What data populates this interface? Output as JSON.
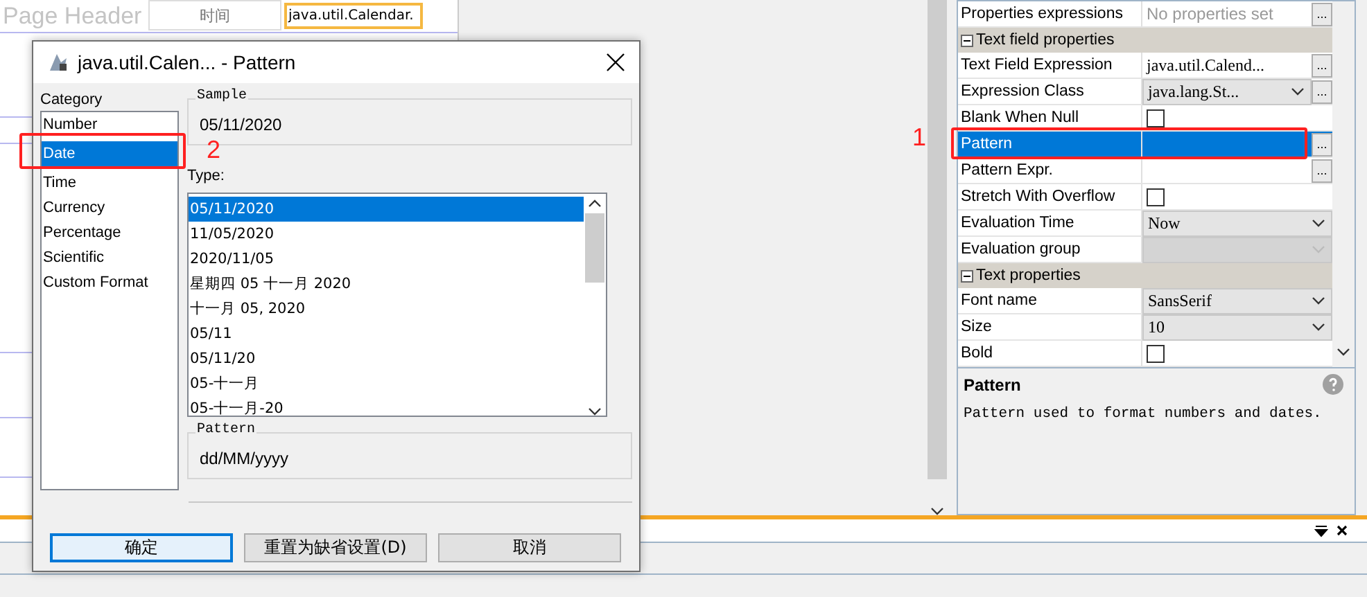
{
  "designer": {
    "header_label": "Page Header",
    "cells": [
      {
        "text": "时间",
        "kind": "static",
        "selected": false
      },
      {
        "text": "java.util.Calendar.",
        "kind": "field",
        "selected": true
      }
    ]
  },
  "properties": {
    "rows": [
      {
        "kind": "text",
        "label": "Properties expressions",
        "value": "No properties set",
        "muted": true,
        "ellipsis": "...",
        "selected": false
      },
      {
        "kind": "section",
        "label": "Text field properties"
      },
      {
        "kind": "text",
        "label": "Text Field Expression",
        "value": "java.util.Calend...",
        "muted": false,
        "ellipsis": "...",
        "selected": false
      },
      {
        "kind": "combo",
        "label": "Expression Class",
        "value": "java.lang.St...",
        "ellipsis": "...",
        "disabled": false,
        "selected": false
      },
      {
        "kind": "check",
        "label": "Blank When Null",
        "checked": false,
        "selected": false
      },
      {
        "kind": "text",
        "label": "Pattern",
        "ellipsis": "...",
        "selected": true
      },
      {
        "kind": "text",
        "label": "Pattern Expr.",
        "ellipsis": "...",
        "selected": false
      },
      {
        "kind": "check",
        "label": "Stretch With Overflow",
        "checked": false,
        "selected": false
      },
      {
        "kind": "combo",
        "label": "Evaluation Time",
        "value": "Now",
        "disabled": false,
        "selected": false
      },
      {
        "kind": "combo",
        "label": "Evaluation group",
        "disabled": true,
        "selected": false
      },
      {
        "kind": "section",
        "label": "Text properties"
      },
      {
        "kind": "combo",
        "label": "Font name",
        "value": "SansSerif",
        "disabled": false,
        "selected": false
      },
      {
        "kind": "combo",
        "label": "Size",
        "value": "10",
        "disabled": false,
        "selected": false
      },
      {
        "kind": "check",
        "label": "Bold",
        "checked": false,
        "selected": false
      }
    ],
    "help": {
      "title": "Pattern",
      "text": "Pattern used to format numbers and dates."
    }
  },
  "dialog": {
    "title": "java.util.Calen... - Pattern",
    "category_label": "Category",
    "categories": [
      {
        "label": "Number",
        "selected": false
      },
      {
        "label": "Date",
        "selected": true
      },
      {
        "label": "Time",
        "selected": false
      },
      {
        "label": "Currency",
        "selected": false
      },
      {
        "label": "Percentage",
        "selected": false
      },
      {
        "label": "Scientific",
        "selected": false
      },
      {
        "label": "Custom Format",
        "selected": false
      }
    ],
    "sample_label": "Sample",
    "sample": "05/11/2020",
    "type_label": "Type:",
    "types": [
      {
        "label": "05/11/2020",
        "selected": true
      },
      {
        "label": "11/05/2020",
        "selected": false
      },
      {
        "label": "2020/11/05",
        "selected": false
      },
      {
        "label": "星期四 05 十一月 2020",
        "selected": false
      },
      {
        "label": "十一月 05, 2020",
        "selected": false
      },
      {
        "label": "05/11",
        "selected": false
      },
      {
        "label": "05/11/20",
        "selected": false
      },
      {
        "label": "05-十一月",
        "selected": false
      },
      {
        "label": "05-十一月-20",
        "selected": false
      }
    ],
    "pattern_label": "Pattern",
    "pattern": "dd/MM/yyyy",
    "buttons": [
      {
        "label": "确定",
        "default": true
      },
      {
        "label": "重置为缺省设置(D)",
        "default": false
      },
      {
        "label": "取消",
        "default": false
      }
    ]
  },
  "annotations": [
    {
      "number": "2"
    },
    {
      "number": "1"
    }
  ]
}
